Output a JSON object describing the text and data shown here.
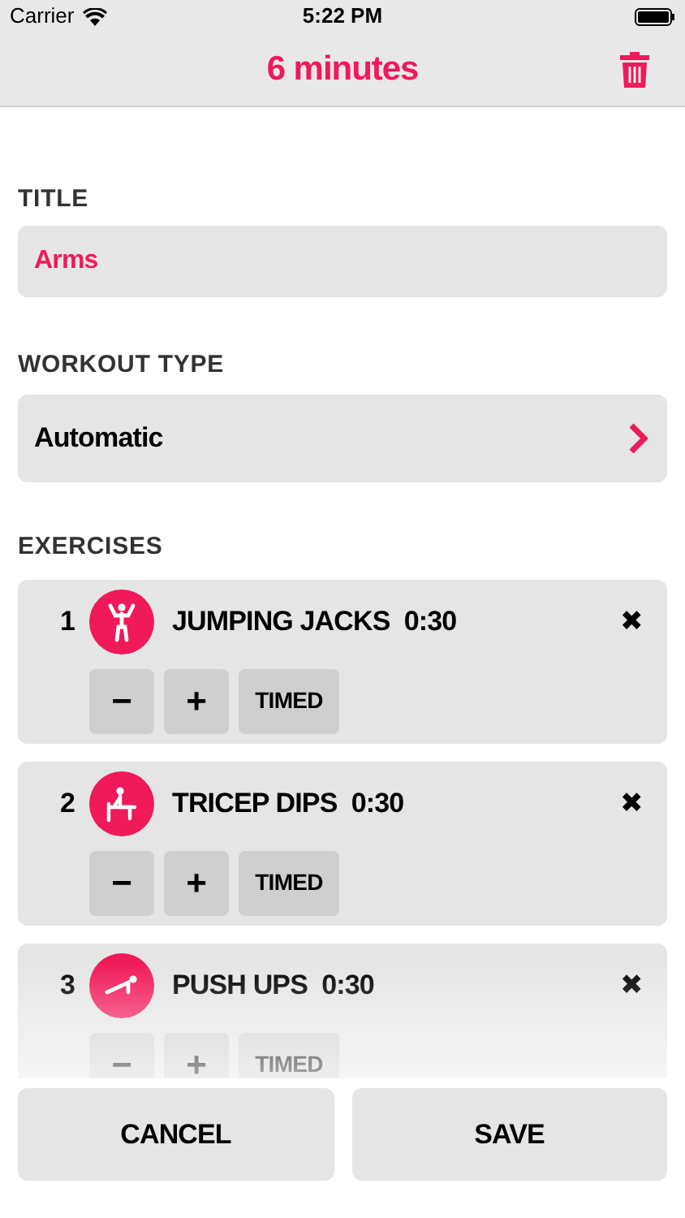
{
  "status_bar": {
    "carrier": "Carrier",
    "time": "5:22 PM"
  },
  "nav": {
    "title": "6 minutes"
  },
  "title_section": {
    "label": "TITLE",
    "value": "Arms"
  },
  "workout_type": {
    "label": "WORKOUT TYPE",
    "value": "Automatic"
  },
  "exercises": {
    "label": "EXERCISES",
    "items": [
      {
        "number": "1",
        "kind": "jumping",
        "name": "JUMPING JACKS",
        "duration": "0:30",
        "minus": "−",
        "plus": "+",
        "mode": "TIMED",
        "remove": "✖"
      },
      {
        "number": "2",
        "kind": "dips",
        "name": "TRICEP DIPS",
        "duration": "0:30",
        "minus": "−",
        "plus": "+",
        "mode": "TIMED",
        "remove": "✖"
      },
      {
        "number": "3",
        "kind": "pushup",
        "name": "PUSH UPS",
        "duration": "0:30",
        "minus": "−",
        "plus": "+",
        "mode": "TIMED",
        "remove": "✖"
      }
    ]
  },
  "buttons": {
    "cancel": "CANCEL",
    "save": "SAVE"
  }
}
